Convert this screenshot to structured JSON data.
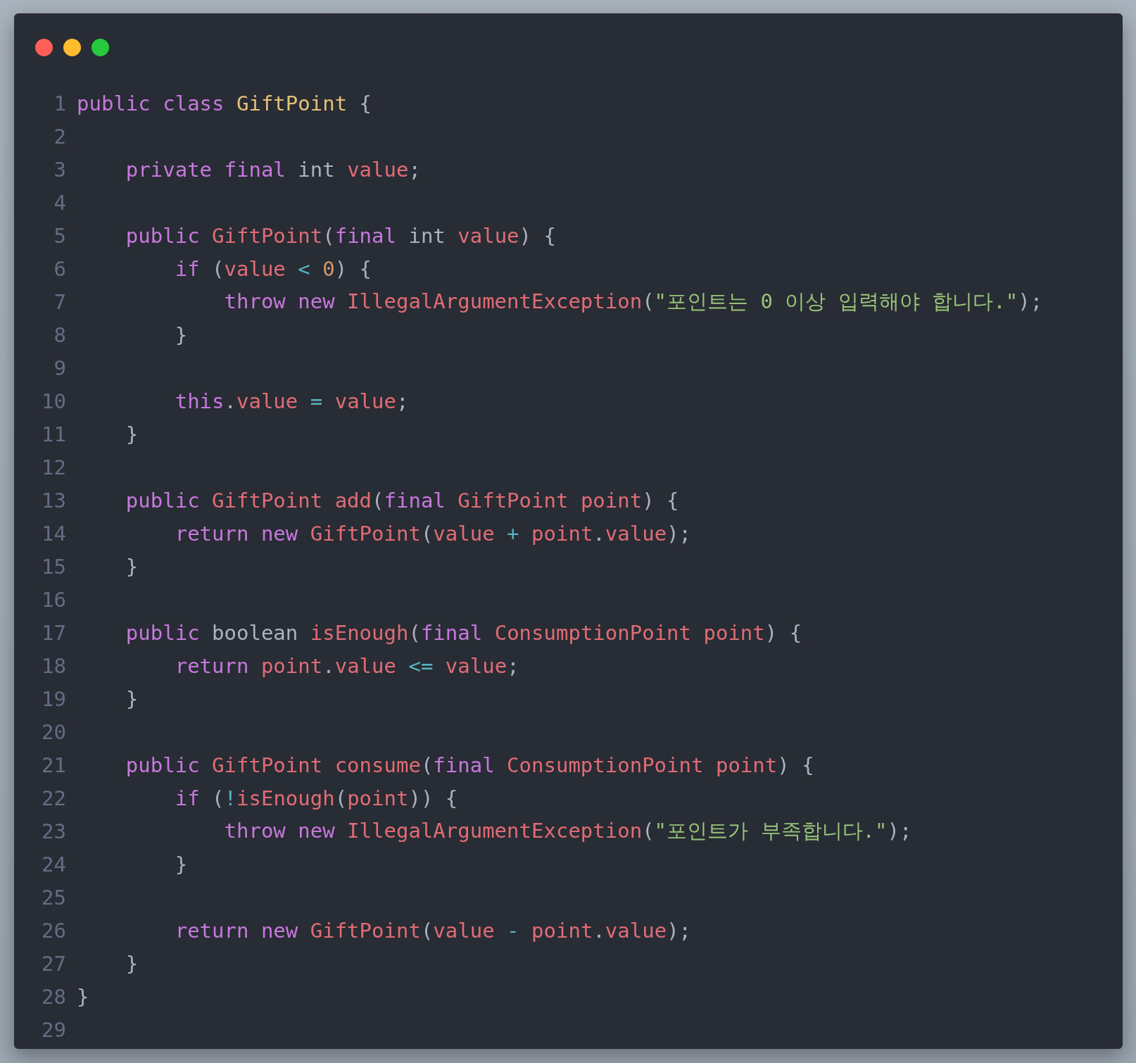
{
  "lines": [
    {
      "number": "1",
      "tokens": [
        {
          "kind": "keyword",
          "text": "public class "
        },
        {
          "kind": "class",
          "text": "GiftPoint"
        },
        {
          "kind": "plain",
          "text": " {"
        }
      ]
    },
    {
      "number": "2"
    },
    {
      "number": "3",
      "tokens": [
        {
          "kind": "keyword",
          "text": "    private final "
        },
        {
          "kind": "plain",
          "text": "int "
        },
        {
          "kind": "name",
          "text": "value"
        },
        {
          "kind": "plain",
          "text": ";"
        }
      ]
    },
    {
      "number": "4"
    },
    {
      "number": "5",
      "tokens": [
        {
          "kind": "keyword",
          "text": "    public "
        },
        {
          "kind": "name",
          "text": "GiftPoint"
        },
        {
          "kind": "plain",
          "text": "("
        },
        {
          "kind": "keyword",
          "text": "final "
        },
        {
          "kind": "plain",
          "text": "int "
        },
        {
          "kind": "name",
          "text": "value"
        },
        {
          "kind": "plain",
          "text": ") {"
        }
      ]
    },
    {
      "number": "6",
      "tokens": [
        {
          "kind": "keyword",
          "text": "        if "
        },
        {
          "kind": "plain",
          "text": "("
        },
        {
          "kind": "name",
          "text": "value"
        },
        {
          "kind": "operator",
          "text": " < "
        },
        {
          "kind": "number",
          "text": "0"
        },
        {
          "kind": "plain",
          "text": ") {"
        }
      ]
    },
    {
      "number": "7",
      "tokens": [
        {
          "kind": "keyword",
          "text": "            throw new "
        },
        {
          "kind": "name",
          "text": "IllegalArgumentException"
        },
        {
          "kind": "plain",
          "text": "("
        },
        {
          "kind": "string",
          "text": "\"포인트는 0 이상 입력해야 합니다.\""
        },
        {
          "kind": "plain",
          "text": ");"
        }
      ]
    },
    {
      "number": "8",
      "tokens": [
        {
          "kind": "plain",
          "text": "        }"
        }
      ]
    },
    {
      "number": "9"
    },
    {
      "number": "10",
      "tokens": [
        {
          "kind": "keyword",
          "text": "        this"
        },
        {
          "kind": "plain",
          "text": "."
        },
        {
          "kind": "name",
          "text": "value"
        },
        {
          "kind": "operator",
          "text": " = "
        },
        {
          "kind": "name",
          "text": "value"
        },
        {
          "kind": "plain",
          "text": ";"
        }
      ]
    },
    {
      "number": "11",
      "tokens": [
        {
          "kind": "plain",
          "text": "    }"
        }
      ]
    },
    {
      "number": "12"
    },
    {
      "number": "13",
      "tokens": [
        {
          "kind": "keyword",
          "text": "    public "
        },
        {
          "kind": "name",
          "text": "GiftPoint add"
        },
        {
          "kind": "plain",
          "text": "("
        },
        {
          "kind": "keyword",
          "text": "final "
        },
        {
          "kind": "name",
          "text": "GiftPoint point"
        },
        {
          "kind": "plain",
          "text": ") {"
        }
      ]
    },
    {
      "number": "14",
      "tokens": [
        {
          "kind": "keyword",
          "text": "        return new "
        },
        {
          "kind": "name",
          "text": "GiftPoint"
        },
        {
          "kind": "plain",
          "text": "("
        },
        {
          "kind": "name",
          "text": "value"
        },
        {
          "kind": "operator",
          "text": " + "
        },
        {
          "kind": "name",
          "text": "point"
        },
        {
          "kind": "plain",
          "text": "."
        },
        {
          "kind": "name",
          "text": "value"
        },
        {
          "kind": "plain",
          "text": ");"
        }
      ]
    },
    {
      "number": "15",
      "tokens": [
        {
          "kind": "plain",
          "text": "    }"
        }
      ]
    },
    {
      "number": "16"
    },
    {
      "number": "17",
      "tokens": [
        {
          "kind": "keyword",
          "text": "    public "
        },
        {
          "kind": "plain",
          "text": "boolean "
        },
        {
          "kind": "name",
          "text": "isEnough"
        },
        {
          "kind": "plain",
          "text": "("
        },
        {
          "kind": "keyword",
          "text": "final "
        },
        {
          "kind": "name",
          "text": "ConsumptionPoint point"
        },
        {
          "kind": "plain",
          "text": ") {"
        }
      ]
    },
    {
      "number": "18",
      "tokens": [
        {
          "kind": "keyword",
          "text": "        return "
        },
        {
          "kind": "name",
          "text": "point"
        },
        {
          "kind": "plain",
          "text": "."
        },
        {
          "kind": "name",
          "text": "value"
        },
        {
          "kind": "operator",
          "text": " <= "
        },
        {
          "kind": "name",
          "text": "value"
        },
        {
          "kind": "plain",
          "text": ";"
        }
      ]
    },
    {
      "number": "19",
      "tokens": [
        {
          "kind": "plain",
          "text": "    }"
        }
      ]
    },
    {
      "number": "20"
    },
    {
      "number": "21",
      "tokens": [
        {
          "kind": "keyword",
          "text": "    public "
        },
        {
          "kind": "name",
          "text": "GiftPoint consume"
        },
        {
          "kind": "plain",
          "text": "("
        },
        {
          "kind": "keyword",
          "text": "final "
        },
        {
          "kind": "name",
          "text": "ConsumptionPoint point"
        },
        {
          "kind": "plain",
          "text": ") {"
        }
      ]
    },
    {
      "number": "22",
      "tokens": [
        {
          "kind": "keyword",
          "text": "        if "
        },
        {
          "kind": "plain",
          "text": "("
        },
        {
          "kind": "operator",
          "text": "!"
        },
        {
          "kind": "name",
          "text": "isEnough"
        },
        {
          "kind": "plain",
          "text": "("
        },
        {
          "kind": "name",
          "text": "point"
        },
        {
          "kind": "plain",
          "text": ")) {"
        }
      ]
    },
    {
      "number": "23",
      "tokens": [
        {
          "kind": "keyword",
          "text": "            throw new "
        },
        {
          "kind": "name",
          "text": "IllegalArgumentException"
        },
        {
          "kind": "plain",
          "text": "("
        },
        {
          "kind": "string",
          "text": "\"포인트가 부족합니다.\""
        },
        {
          "kind": "plain",
          "text": ");"
        }
      ]
    },
    {
      "number": "24",
      "tokens": [
        {
          "kind": "plain",
          "text": "        }"
        }
      ]
    },
    {
      "number": "25"
    },
    {
      "number": "26",
      "tokens": [
        {
          "kind": "keyword",
          "text": "        return new "
        },
        {
          "kind": "name",
          "text": "GiftPoint"
        },
        {
          "kind": "plain",
          "text": "("
        },
        {
          "kind": "name",
          "text": "value"
        },
        {
          "kind": "operator",
          "text": " - "
        },
        {
          "kind": "name",
          "text": "point"
        },
        {
          "kind": "plain",
          "text": "."
        },
        {
          "kind": "name",
          "text": "value"
        },
        {
          "kind": "plain",
          "text": ");"
        }
      ]
    },
    {
      "number": "27",
      "tokens": [
        {
          "kind": "plain",
          "text": "    }"
        }
      ]
    },
    {
      "number": "28",
      "tokens": [
        {
          "kind": "plain",
          "text": "}"
        }
      ]
    },
    {
      "number": "29"
    }
  ]
}
